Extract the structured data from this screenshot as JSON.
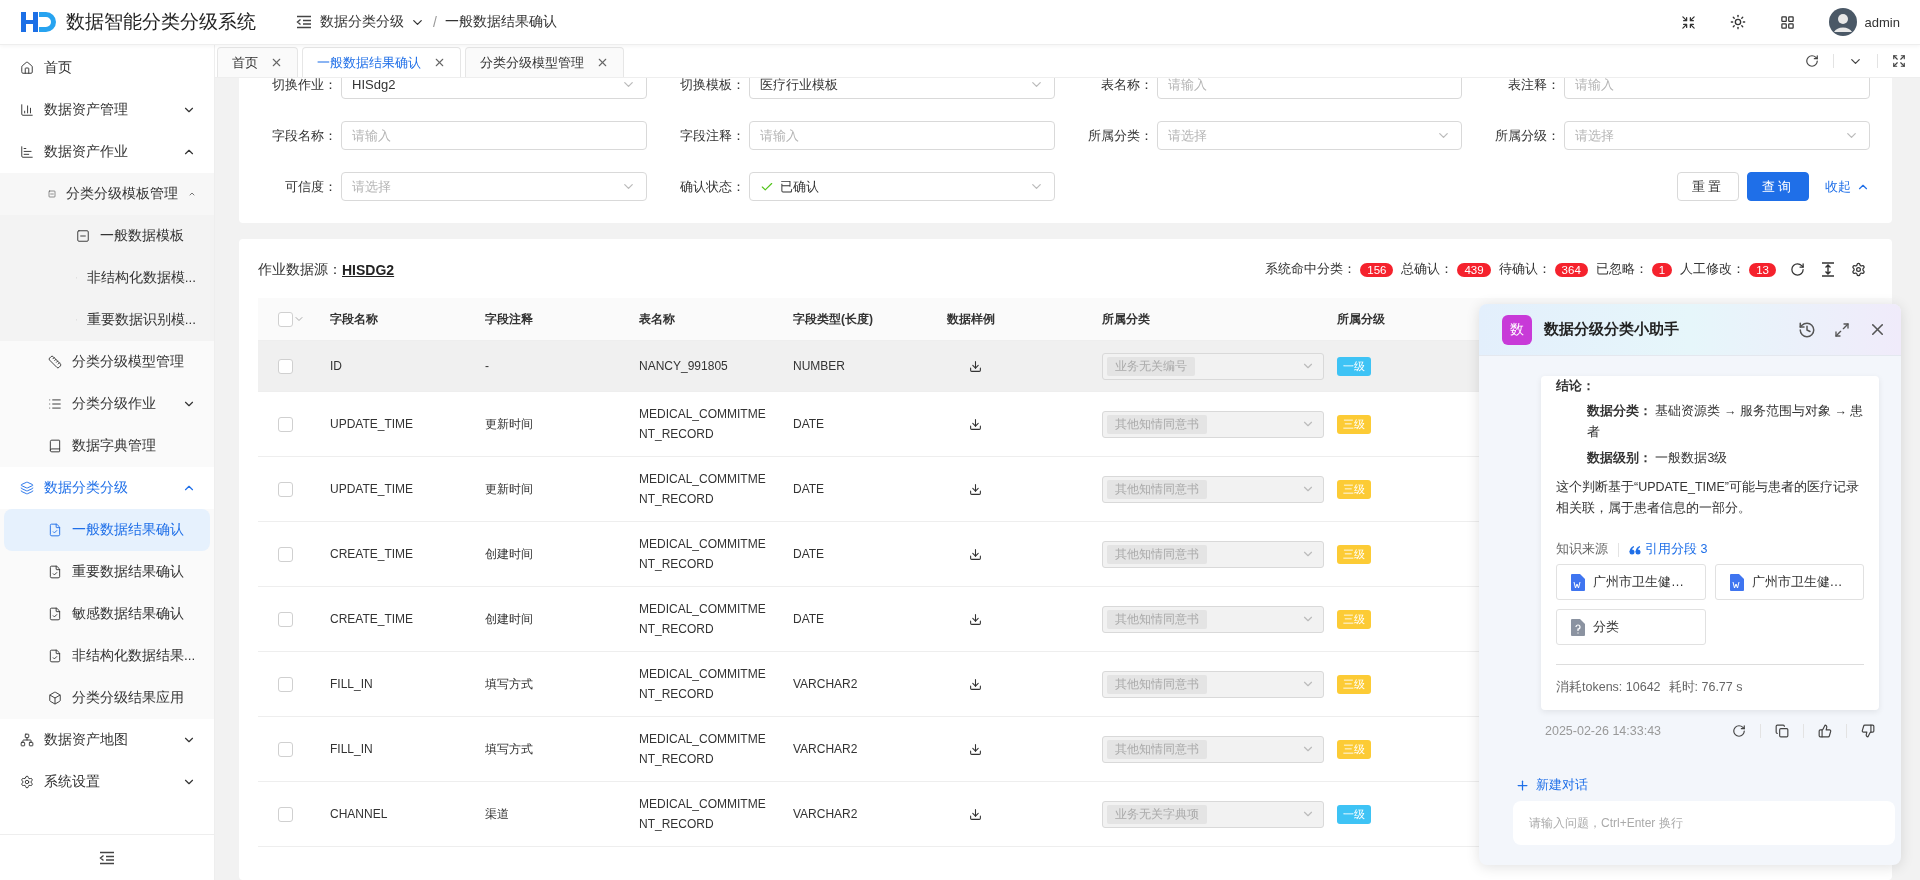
{
  "app": {
    "title": "数据智能分类分级系统"
  },
  "breadcrumb_separator": "/",
  "breadcrumb": [
    {
      "label": "数据分类分级",
      "dropdown": true
    },
    {
      "label": "一般数据结果确认",
      "dropdown": false
    }
  ],
  "user": {
    "name": "admin"
  },
  "sidebar": {
    "items": [
      {
        "label": "首页",
        "selected": false
      },
      {
        "label": "数据资产管理",
        "selected": false,
        "expanded": false
      },
      {
        "label": "数据资产作业",
        "selected": false,
        "expanded": true,
        "children": [
          {
            "label": "分类分级模板管理",
            "selected": false,
            "expanded": true,
            "children": [
              {
                "label": "一般数据模板",
                "selected": false
              },
              {
                "label": "非结构化数据模...",
                "selected": false
              },
              {
                "label": "重要数据识别模...",
                "selected": false
              }
            ]
          },
          {
            "label": "分类分级模型管理",
            "selected": false
          },
          {
            "label": "分类分级作业",
            "selected": false,
            "expanded": false
          },
          {
            "label": "数据字典管理",
            "selected": false
          }
        ]
      },
      {
        "label": "数据分类分级",
        "selected": false,
        "expanded": true,
        "children": [
          {
            "label": "一般数据结果确认",
            "selected": true
          },
          {
            "label": "重要数据结果确认",
            "selected": false
          },
          {
            "label": "敏感数据结果确认",
            "selected": false
          },
          {
            "label": "非结构化数据结果...",
            "selected": false
          },
          {
            "label": "分类分级结果应用",
            "selected": false
          }
        ]
      },
      {
        "label": "数据资产地图",
        "selected": false,
        "expanded": false
      },
      {
        "label": "系统设置",
        "selected": false,
        "expanded": false
      }
    ]
  },
  "tabs": [
    {
      "label": "首页",
      "selected": false
    },
    {
      "label": "一般数据结果确认",
      "selected": true
    },
    {
      "label": "分类分级模型管理",
      "selected": false
    }
  ],
  "filters": [
    {
      "label": "切换作业：",
      "kind": "select",
      "value": "HISdg2"
    },
    {
      "label": "切换模板：",
      "kind": "select",
      "value": "医疗行业模板"
    },
    {
      "label": "表名称：",
      "kind": "input",
      "placeholder": "请输入"
    },
    {
      "label": "表注释：",
      "kind": "input",
      "placeholder": "请输入"
    },
    {
      "label": "字段名称：",
      "kind": "input",
      "placeholder": "请输入"
    },
    {
      "label": "字段注释：",
      "kind": "input",
      "placeholder": "请输入"
    },
    {
      "label": "所属分类：",
      "kind": "select",
      "placeholder": "请选择"
    },
    {
      "label": "所属分级：",
      "kind": "select",
      "placeholder": "请选择"
    },
    {
      "label": "可信度：",
      "kind": "select",
      "placeholder": "请选择"
    },
    {
      "label": "确认状态：",
      "kind": "select",
      "value": "已确认",
      "checked": true
    }
  ],
  "filter_actions": {
    "reset": "重置",
    "search": "查询",
    "collapse": "收起"
  },
  "datasource": {
    "label": "作业数据源：",
    "value": "HISDG2"
  },
  "stats": [
    {
      "label": "系统命中分类：",
      "count": "156"
    },
    {
      "label": "总确认：",
      "count": "439"
    },
    {
      "label": "待确认：",
      "count": "364"
    },
    {
      "label": "已忽略：",
      "count": "1"
    },
    {
      "label": "人工修改：",
      "count": "13"
    }
  ],
  "table": {
    "all_checked": false,
    "columns": [
      "字段名称",
      "字段注释",
      "表名称",
      "字段类型(长度)",
      "数据样例",
      "所属分类",
      "所属分级"
    ],
    "rows": [
      {
        "checked": false,
        "highlighted": true,
        "field": "ID",
        "comment": "-",
        "table": "NANCY_991805",
        "type": "NUMBER",
        "category": {
          "value": "业务无关编号",
          "disabled": true
        },
        "grade": {
          "label": "一级",
          "color": "#3ec3f5"
        }
      },
      {
        "checked": false,
        "highlighted": false,
        "field": "UPDATE_TIME",
        "comment": "更新时间",
        "table": "MEDICAL_COMMITMENT_RECORD",
        "type": "DATE",
        "category": {
          "value": "其他知情同意书",
          "disabled": true
        },
        "grade": {
          "label": "三级",
          "color": "#fccb35"
        }
      },
      {
        "checked": false,
        "highlighted": false,
        "field": "UPDATE_TIME",
        "comment": "更新时间",
        "table": "MEDICAL_COMMITMENT_RECORD",
        "type": "DATE",
        "category": {
          "value": "其他知情同意书",
          "disabled": true
        },
        "grade": {
          "label": "三级",
          "color": "#fccb35"
        }
      },
      {
        "checked": false,
        "highlighted": false,
        "field": "CREATE_TIME",
        "comment": "创建时间",
        "table": "MEDICAL_COMMITMENT_RECORD",
        "type": "DATE",
        "category": {
          "value": "其他知情同意书",
          "disabled": true
        },
        "grade": {
          "label": "三级",
          "color": "#fccb35"
        }
      },
      {
        "checked": false,
        "highlighted": false,
        "field": "CREATE_TIME",
        "comment": "创建时间",
        "table": "MEDICAL_COMMITMENT_RECORD",
        "type": "DATE",
        "category": {
          "value": "其他知情同意书",
          "disabled": true
        },
        "grade": {
          "label": "三级",
          "color": "#fccb35"
        }
      },
      {
        "checked": false,
        "highlighted": false,
        "field": "FILL_IN",
        "comment": "填写方式",
        "table": "MEDICAL_COMMITMENT_RECORD",
        "type": "VARCHAR2",
        "category": {
          "value": "其他知情同意书",
          "disabled": true
        },
        "grade": {
          "label": "三级",
          "color": "#fccb35"
        }
      },
      {
        "checked": false,
        "highlighted": false,
        "field": "FILL_IN",
        "comment": "填写方式",
        "table": "MEDICAL_COMMITMENT_RECORD",
        "type": "VARCHAR2",
        "category": {
          "value": "其他知情同意书",
          "disabled": true
        },
        "grade": {
          "label": "三级",
          "color": "#fccb35"
        }
      },
      {
        "checked": false,
        "highlighted": false,
        "field": "CHANNEL",
        "comment": "渠道",
        "table": "MEDICAL_COMMITMENT_RECORD",
        "type": "VARCHAR2",
        "category": {
          "value": "业务无关字典项",
          "disabled": true
        },
        "grade": {
          "label": "一级",
          "color": "#3ec3f5"
        }
      }
    ]
  },
  "assistant": {
    "avatar": "数",
    "title": "数据分级分类小助手",
    "answer": {
      "heading": "结论：",
      "facts": [
        {
          "label": "数据分类：",
          "value": "基础资源类 → 服务范围与对象 → 患者"
        },
        {
          "label": "数据级别：",
          "value": "一般数据3级"
        }
      ],
      "text": "这个判断基于“UPDATE_TIME”可能与患者的医疗记录相关联，属于患者信息的一部分。",
      "sources_label": "知识来源",
      "cite": "引用分段 3",
      "documents": [
        {
          "name": "广州市卫生健…",
          "kind": "word"
        },
        {
          "name": "广州市卫生健…",
          "kind": "word"
        },
        {
          "name": "分类",
          "kind": "unknown"
        }
      ],
      "tokens": "消耗tokens: 10642",
      "time": "耗时: 76.77 s"
    },
    "timestamp": "2025-02-26 14:33:43",
    "new_chat": "新建对话",
    "input": {
      "placeholder": "请输入问题，Ctrl+Enter 换行"
    }
  }
}
